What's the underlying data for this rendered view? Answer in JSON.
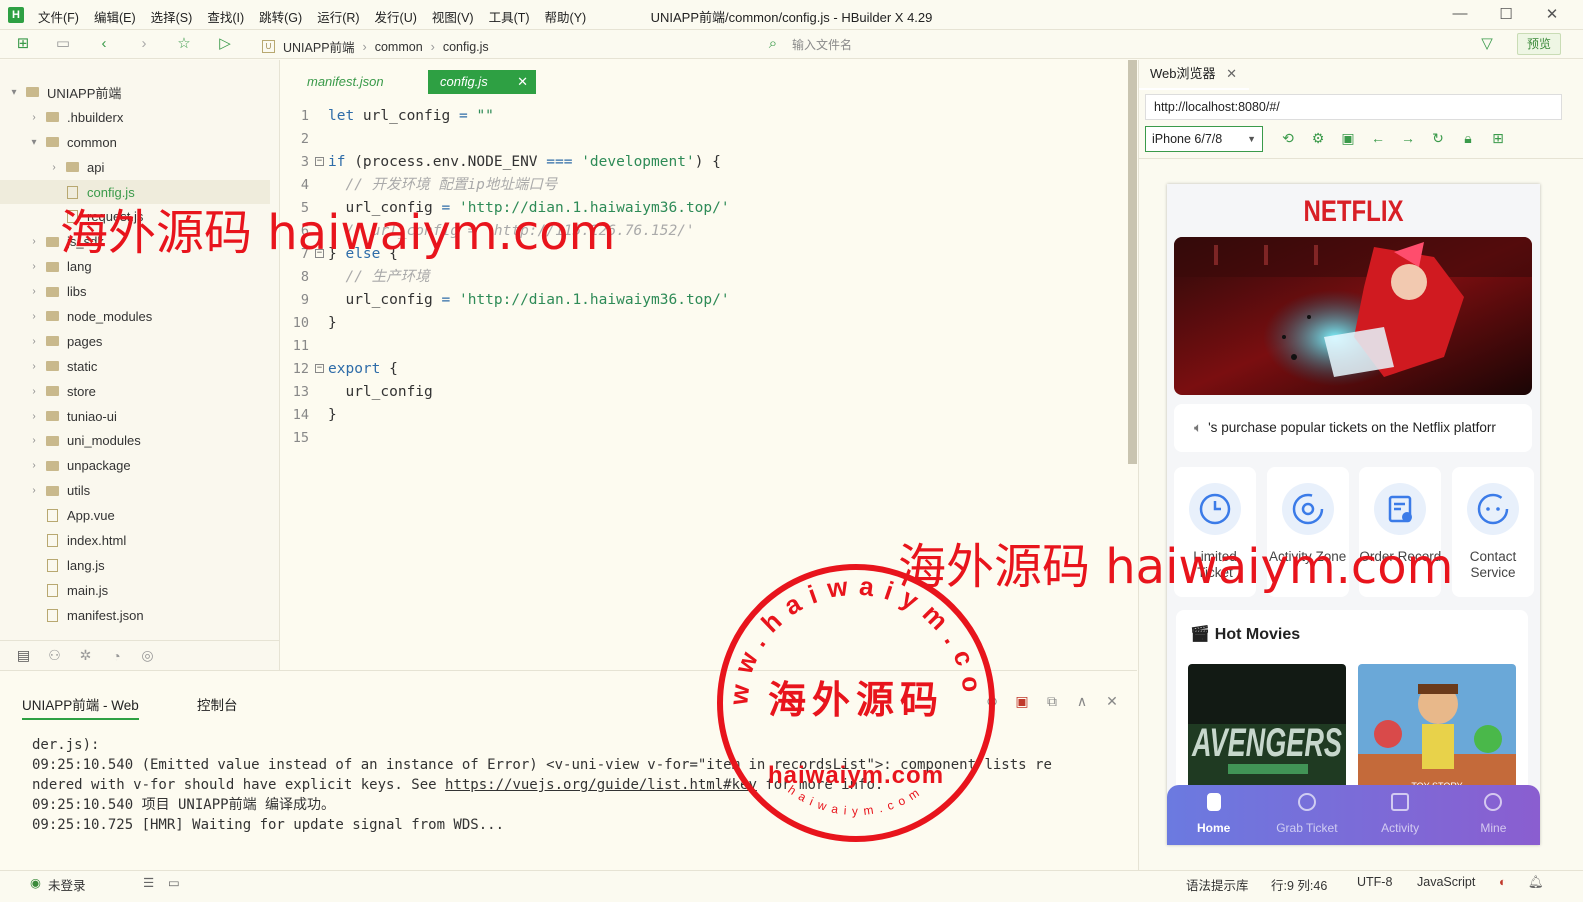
{
  "window": {
    "title": "UNIAPP前端/common/config.js - HBuilder X 4.29",
    "app_logo": "H",
    "menu": [
      "文件(F)",
      "编辑(E)",
      "选择(S)",
      "查找(I)",
      "跳转(G)",
      "运行(R)",
      "发行(U)",
      "视图(V)",
      "工具(T)",
      "帮助(Y)"
    ]
  },
  "toolbar": {
    "breadcrumb": [
      "UNIAPP前端",
      "common",
      "config.js"
    ],
    "file_search_placeholder": "输入文件名",
    "preview_label": "预览"
  },
  "sidebar": {
    "tree": [
      {
        "label": "UNIAPP前端",
        "type": "project",
        "expanded": true,
        "depth": 0
      },
      {
        "label": ".hbuilderx",
        "type": "folder",
        "expanded": false,
        "depth": 1
      },
      {
        "label": "common",
        "type": "folder",
        "expanded": true,
        "depth": 1
      },
      {
        "label": "api",
        "type": "folder",
        "expanded": false,
        "depth": 2
      },
      {
        "label": "config.js",
        "type": "file",
        "depth": 2,
        "selected": true
      },
      {
        "label": "request.js",
        "type": "file",
        "depth": 2
      },
      {
        "label": "js_sdk",
        "type": "folder",
        "expanded": false,
        "depth": 1
      },
      {
        "label": "lang",
        "type": "folder",
        "expanded": false,
        "depth": 1
      },
      {
        "label": "libs",
        "type": "folder",
        "expanded": false,
        "depth": 1
      },
      {
        "label": "node_modules",
        "type": "folder",
        "expanded": false,
        "depth": 1
      },
      {
        "label": "pages",
        "type": "folder",
        "expanded": false,
        "depth": 1
      },
      {
        "label": "static",
        "type": "folder",
        "expanded": false,
        "depth": 1
      },
      {
        "label": "store",
        "type": "folder",
        "expanded": false,
        "depth": 1
      },
      {
        "label": "tuniao-ui",
        "type": "folder",
        "expanded": false,
        "depth": 1
      },
      {
        "label": "uni_modules",
        "type": "folder",
        "expanded": false,
        "depth": 1
      },
      {
        "label": "unpackage",
        "type": "folder",
        "expanded": false,
        "depth": 1
      },
      {
        "label": "utils",
        "type": "folder",
        "expanded": false,
        "depth": 1
      },
      {
        "label": "App.vue",
        "type": "file",
        "depth": 1
      },
      {
        "label": "index.html",
        "type": "file",
        "depth": 1
      },
      {
        "label": "lang.js",
        "type": "file",
        "depth": 1
      },
      {
        "label": "main.js",
        "type": "file",
        "depth": 1
      },
      {
        "label": "manifest.json",
        "type": "file",
        "depth": 1
      }
    ]
  },
  "editor": {
    "tabs": [
      {
        "label": "manifest.json",
        "active": false
      },
      {
        "label": "config.js",
        "active": true
      }
    ],
    "line_numbers": [
      "1",
      "2",
      "3",
      "4",
      "5",
      "6",
      "7",
      "8",
      "9",
      "10",
      "11",
      "12",
      "13",
      "14",
      "15"
    ]
  },
  "browser": {
    "tab_label": "Web浏览器",
    "url": "http://localhost:8080/#/",
    "device": "iPhone 6/7/8",
    "phone": {
      "logo": "NETFLIX",
      "notice": "'s purchase popular tickets on the Netflix platforr",
      "quick_actions": [
        "Limited Ticket",
        "Activity Zone",
        "Order Record",
        "Contact Service"
      ],
      "hot_title": "Hot Movies",
      "posters": [
        "AVENGERS",
        "TOY STORY"
      ],
      "tabbar": [
        "Home",
        "Grab Ticket",
        "Activity",
        "Mine"
      ]
    }
  },
  "console": {
    "tabs": [
      "UNIAPP前端 - Web",
      "控制台"
    ],
    "lines": [
      "der.js):",
      "09:25:10.540 (Emitted value instead of an instance of Error) <v-uni-view v-for=\"item in recordsList\">: component lists re",
      "ndered with v-for should have explicit keys. See ",
      "https://vuejs.org/guide/list.html#key",
      " for more info.",
      "09:25:10.540 项目 UNIAPP前端 编译成功。",
      "09:25:10.725 [HMR] Waiting for update signal from WDS..."
    ]
  },
  "statusbar": {
    "login": "未登录",
    "syntax_hint": "语法提示库",
    "position": "行:9  列:46",
    "encoding": "UTF-8",
    "language": "JavaScript"
  },
  "watermark": {
    "text": "海外源码 haiwaiym.com",
    "seal_center": "海外源码",
    "seal_ring": "www.haiwaiym.com",
    "seal_bottom": "haiwaiym.com",
    "seal_small": "haiwaiym.com"
  },
  "colors": {
    "accent": "#2ea043",
    "keyword": "#2e6ca8",
    "string": "#2e8b57",
    "comment": "#aaaaaa",
    "netflix": "#d81f26",
    "watermark": "#e8141c"
  }
}
